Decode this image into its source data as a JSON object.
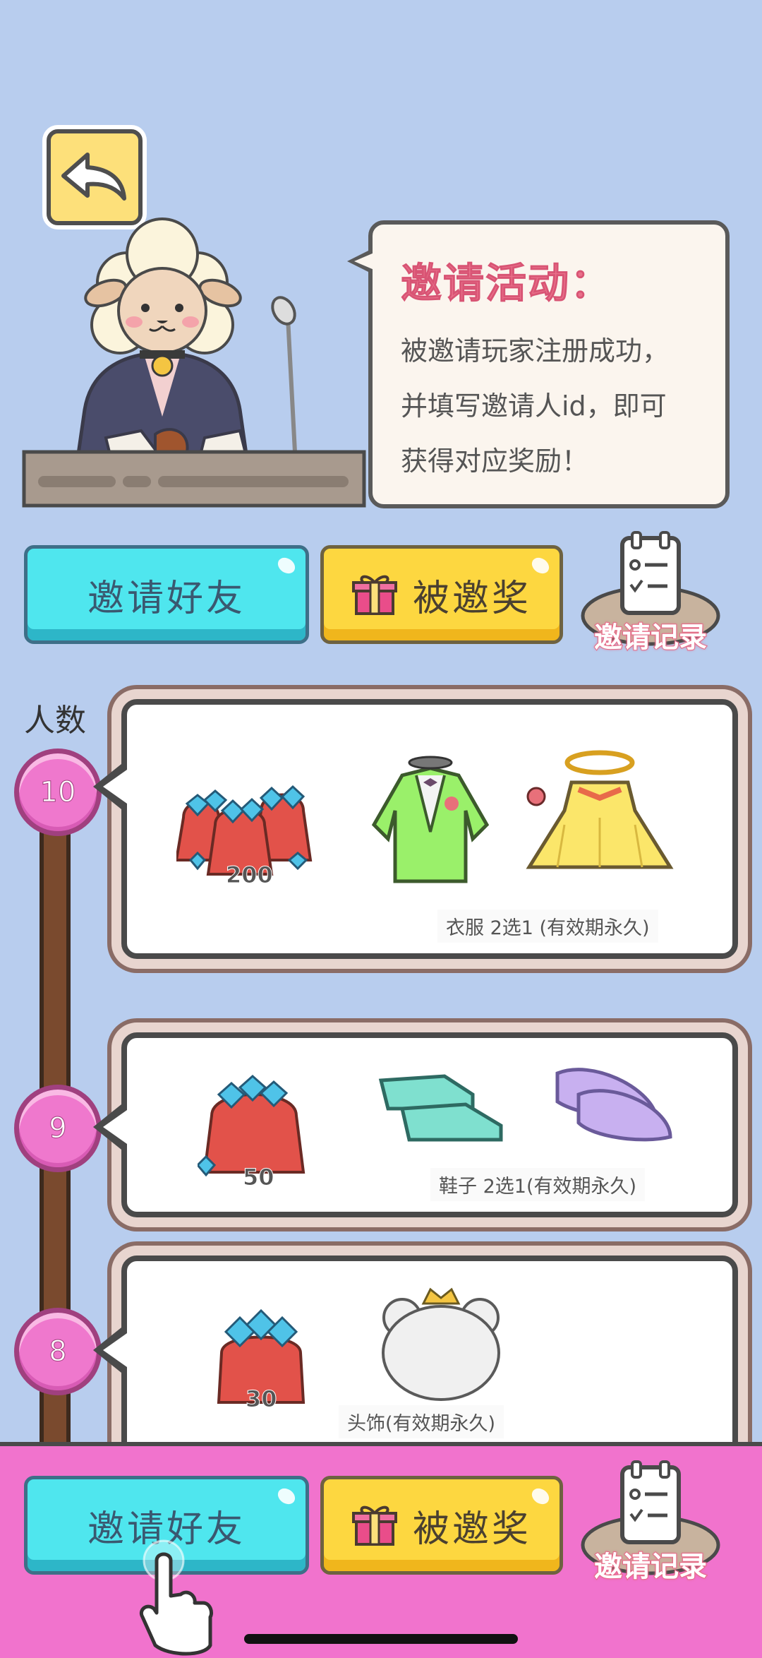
{
  "header": {
    "back_icon": "back-arrow-icon"
  },
  "bubble": {
    "title": "邀请活动：",
    "lines": [
      "被邀请玩家注册成功，",
      "并填写邀请人id，即可",
      "获得对应奖励！"
    ]
  },
  "actions": {
    "invite_friends": "邀请好友",
    "invited_reward": "被邀奖",
    "invite_record": "邀请记录"
  },
  "rewards": {
    "people_label": "人数",
    "tiers": [
      {
        "count": "10",
        "diamonds": "200",
        "caption": "衣服 2选1 (有效期永久)"
      },
      {
        "count": "9",
        "diamonds": "50",
        "caption": "鞋子 2选1(有效期永久)"
      },
      {
        "count": "8",
        "diamonds": "30",
        "caption": "头饰(有效期永久)"
      }
    ]
  },
  "colors": {
    "background": "#b8cdee",
    "cyan_button": "#4fe6ee",
    "yellow_button": "#fdd740",
    "pink_bar": "#f173cd",
    "tier_circle": "#ef78cd",
    "title_pink": "#e9708a"
  }
}
